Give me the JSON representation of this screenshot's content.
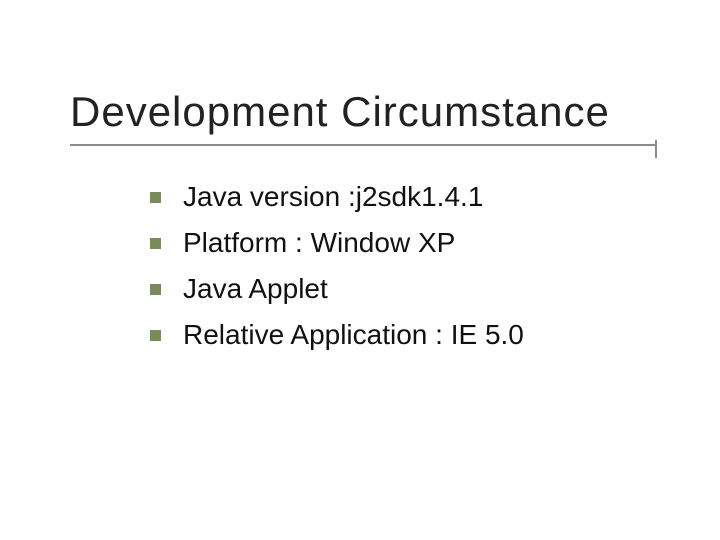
{
  "title": "Development Circumstance",
  "items": [
    "Java  version :j2sdk1.4.1",
    "Platform : Window XP",
    "Java Applet",
    "Relative Application : IE 5.0"
  ]
}
